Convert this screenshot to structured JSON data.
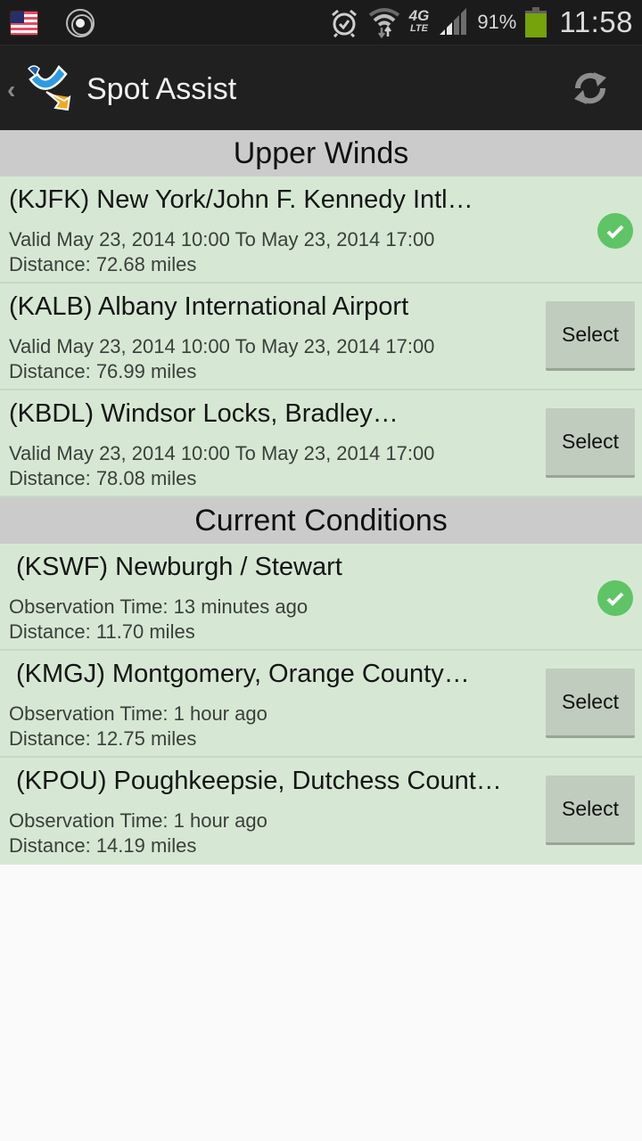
{
  "status_bar": {
    "left_icons": [
      "us-flag-icon",
      "radar-icon"
    ],
    "right_icons": [
      "alarm-icon",
      "wifi-icon",
      "4g-lte-icon",
      "signal-icon",
      "battery-icon"
    ],
    "network_label": "4G",
    "network_sub": "LTE",
    "battery_percent": "91%",
    "battery_level": 0.91,
    "time": "11:58"
  },
  "action_bar": {
    "title": "Spot Assist",
    "up_icon": "chevron-left-icon",
    "logo_icon": "spot-assist-logo",
    "action_icon": "refresh-icon"
  },
  "sections": [
    {
      "header": "Upper Winds",
      "items": [
        {
          "title": "(KJFK) New York/John F. Kennedy Intl…",
          "line1": "Valid May 23, 2014 10:00 To May 23, 2014 17:00",
          "line2": "Distance: 72.68 miles",
          "selected": true
        },
        {
          "title": "(KALB) Albany International Airport",
          "line1": "Valid May 23, 2014 10:00 To May 23, 2014 17:00",
          "line2": "Distance: 76.99 miles",
          "selected": false,
          "button": "Select"
        },
        {
          "title": "(KBDL) Windsor Locks, Bradley…",
          "line1": "Valid May 23, 2014 10:00 To May 23, 2014 17:00",
          "line2": "Distance: 78.08 miles",
          "selected": false,
          "button": "Select"
        }
      ]
    },
    {
      "header": "Current Conditions",
      "items": [
        {
          "title": "(KSWF) Newburgh / Stewart",
          "line1": "Observation Time: 13 minutes ago",
          "line2": "Distance: 11.70 miles",
          "selected": true
        },
        {
          "title": "(KMGJ) Montgomery, Orange County…",
          "line1": "Observation Time: 1 hour ago",
          "line2": "Distance: 12.75 miles",
          "selected": false,
          "button": "Select"
        },
        {
          "title": "(KPOU) Poughkeepsie, Dutchess Count…",
          "line1": "Observation Time: 1 hour ago",
          "line2": "Distance: 14.19 miles",
          "selected": false,
          "button": "Select"
        }
      ]
    }
  ],
  "colors": {
    "row_bg": "#d6e8d4",
    "section_header_bg": "#cbcbcb",
    "check_green": "#5fc466",
    "battery_green": "#75a30c",
    "action_bar_bg": "#202020"
  }
}
